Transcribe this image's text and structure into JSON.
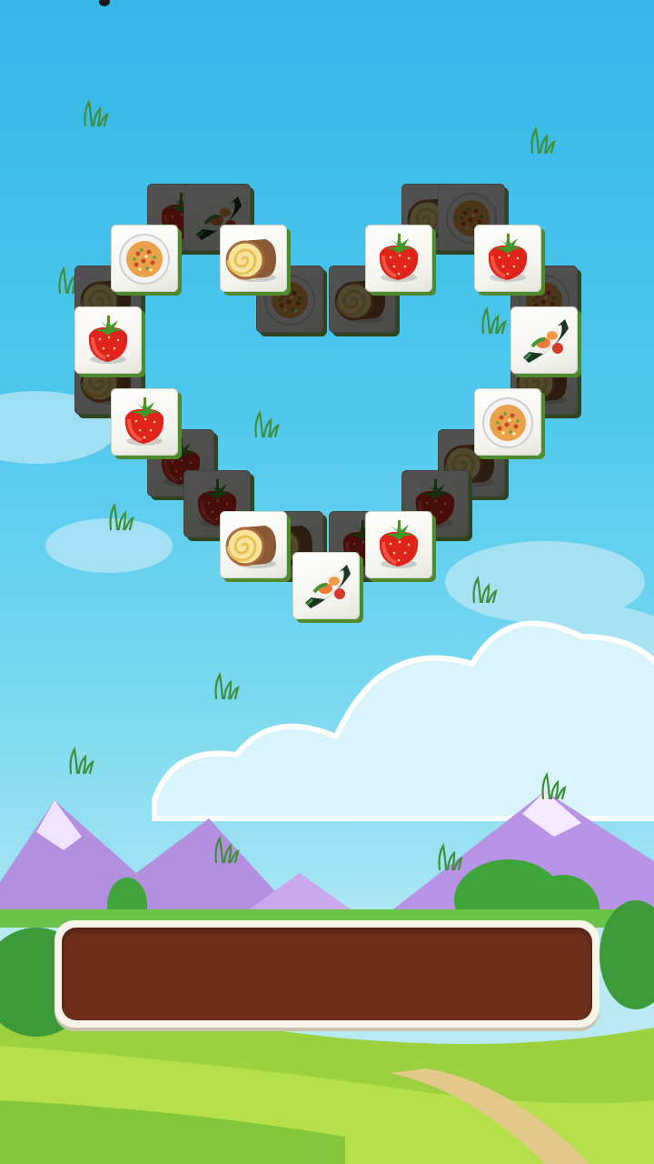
{
  "game": {
    "board_shape": "heart",
    "tray_slots_filled": 0
  },
  "icons": {
    "strawberry": "strawberry-icon",
    "fried_rice": "fried-rice-icon",
    "swiss_roll": "swiss-roll-icon",
    "sushi_hand_roll": "sushi-hand-roll-icon"
  },
  "colors": {
    "sky_top": "#35b6e8",
    "sky_bottom": "#b9e9f3",
    "tile_face": "#ffffff",
    "tile_edge": "#4f8a2c",
    "tray_well": "#6e2e1c",
    "tray_rim": "#f7f4ea"
  }
}
